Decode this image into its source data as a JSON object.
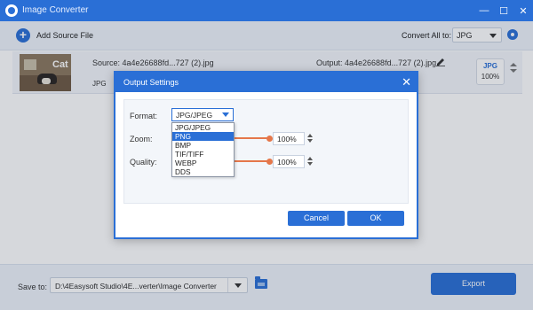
{
  "window": {
    "title": "Image Converter",
    "controls": [
      "minimize",
      "maximize",
      "close"
    ]
  },
  "toolbar": {
    "add_source_label": "Add Source File",
    "convert_all_label": "Convert All to:",
    "convert_all_value": "JPG"
  },
  "file": {
    "thumbnail_text": "Cat",
    "source": "Source: 4a4e26688fd...727 (2).jpg",
    "output": "Output: 4a4e26688fd...727 (2).jpg",
    "format": "JPG",
    "badge_format": "JPG",
    "badge_quality": "100%"
  },
  "bottom": {
    "save_to_label": "Save to:",
    "save_path": "D:\\4Easysoft Studio\\4E...verter\\Image Converter",
    "export_label": "Export"
  },
  "dialog": {
    "title": "Output Settings",
    "format_label": "Format:",
    "format_value": "JPG/JPEG",
    "format_options": [
      "JPG/JPEG",
      "PNG",
      "BMP",
      "TIF/TIFF",
      "WEBP",
      "DDS"
    ],
    "highlighted_option": "PNG",
    "zoom_label": "Zoom:",
    "zoom_value": "100%",
    "quality_label": "Quality:",
    "quality_value": "100%",
    "cancel_label": "Cancel",
    "ok_label": "OK"
  },
  "colors": {
    "accent": "#2a6fd6",
    "slider": "#e5774a"
  }
}
